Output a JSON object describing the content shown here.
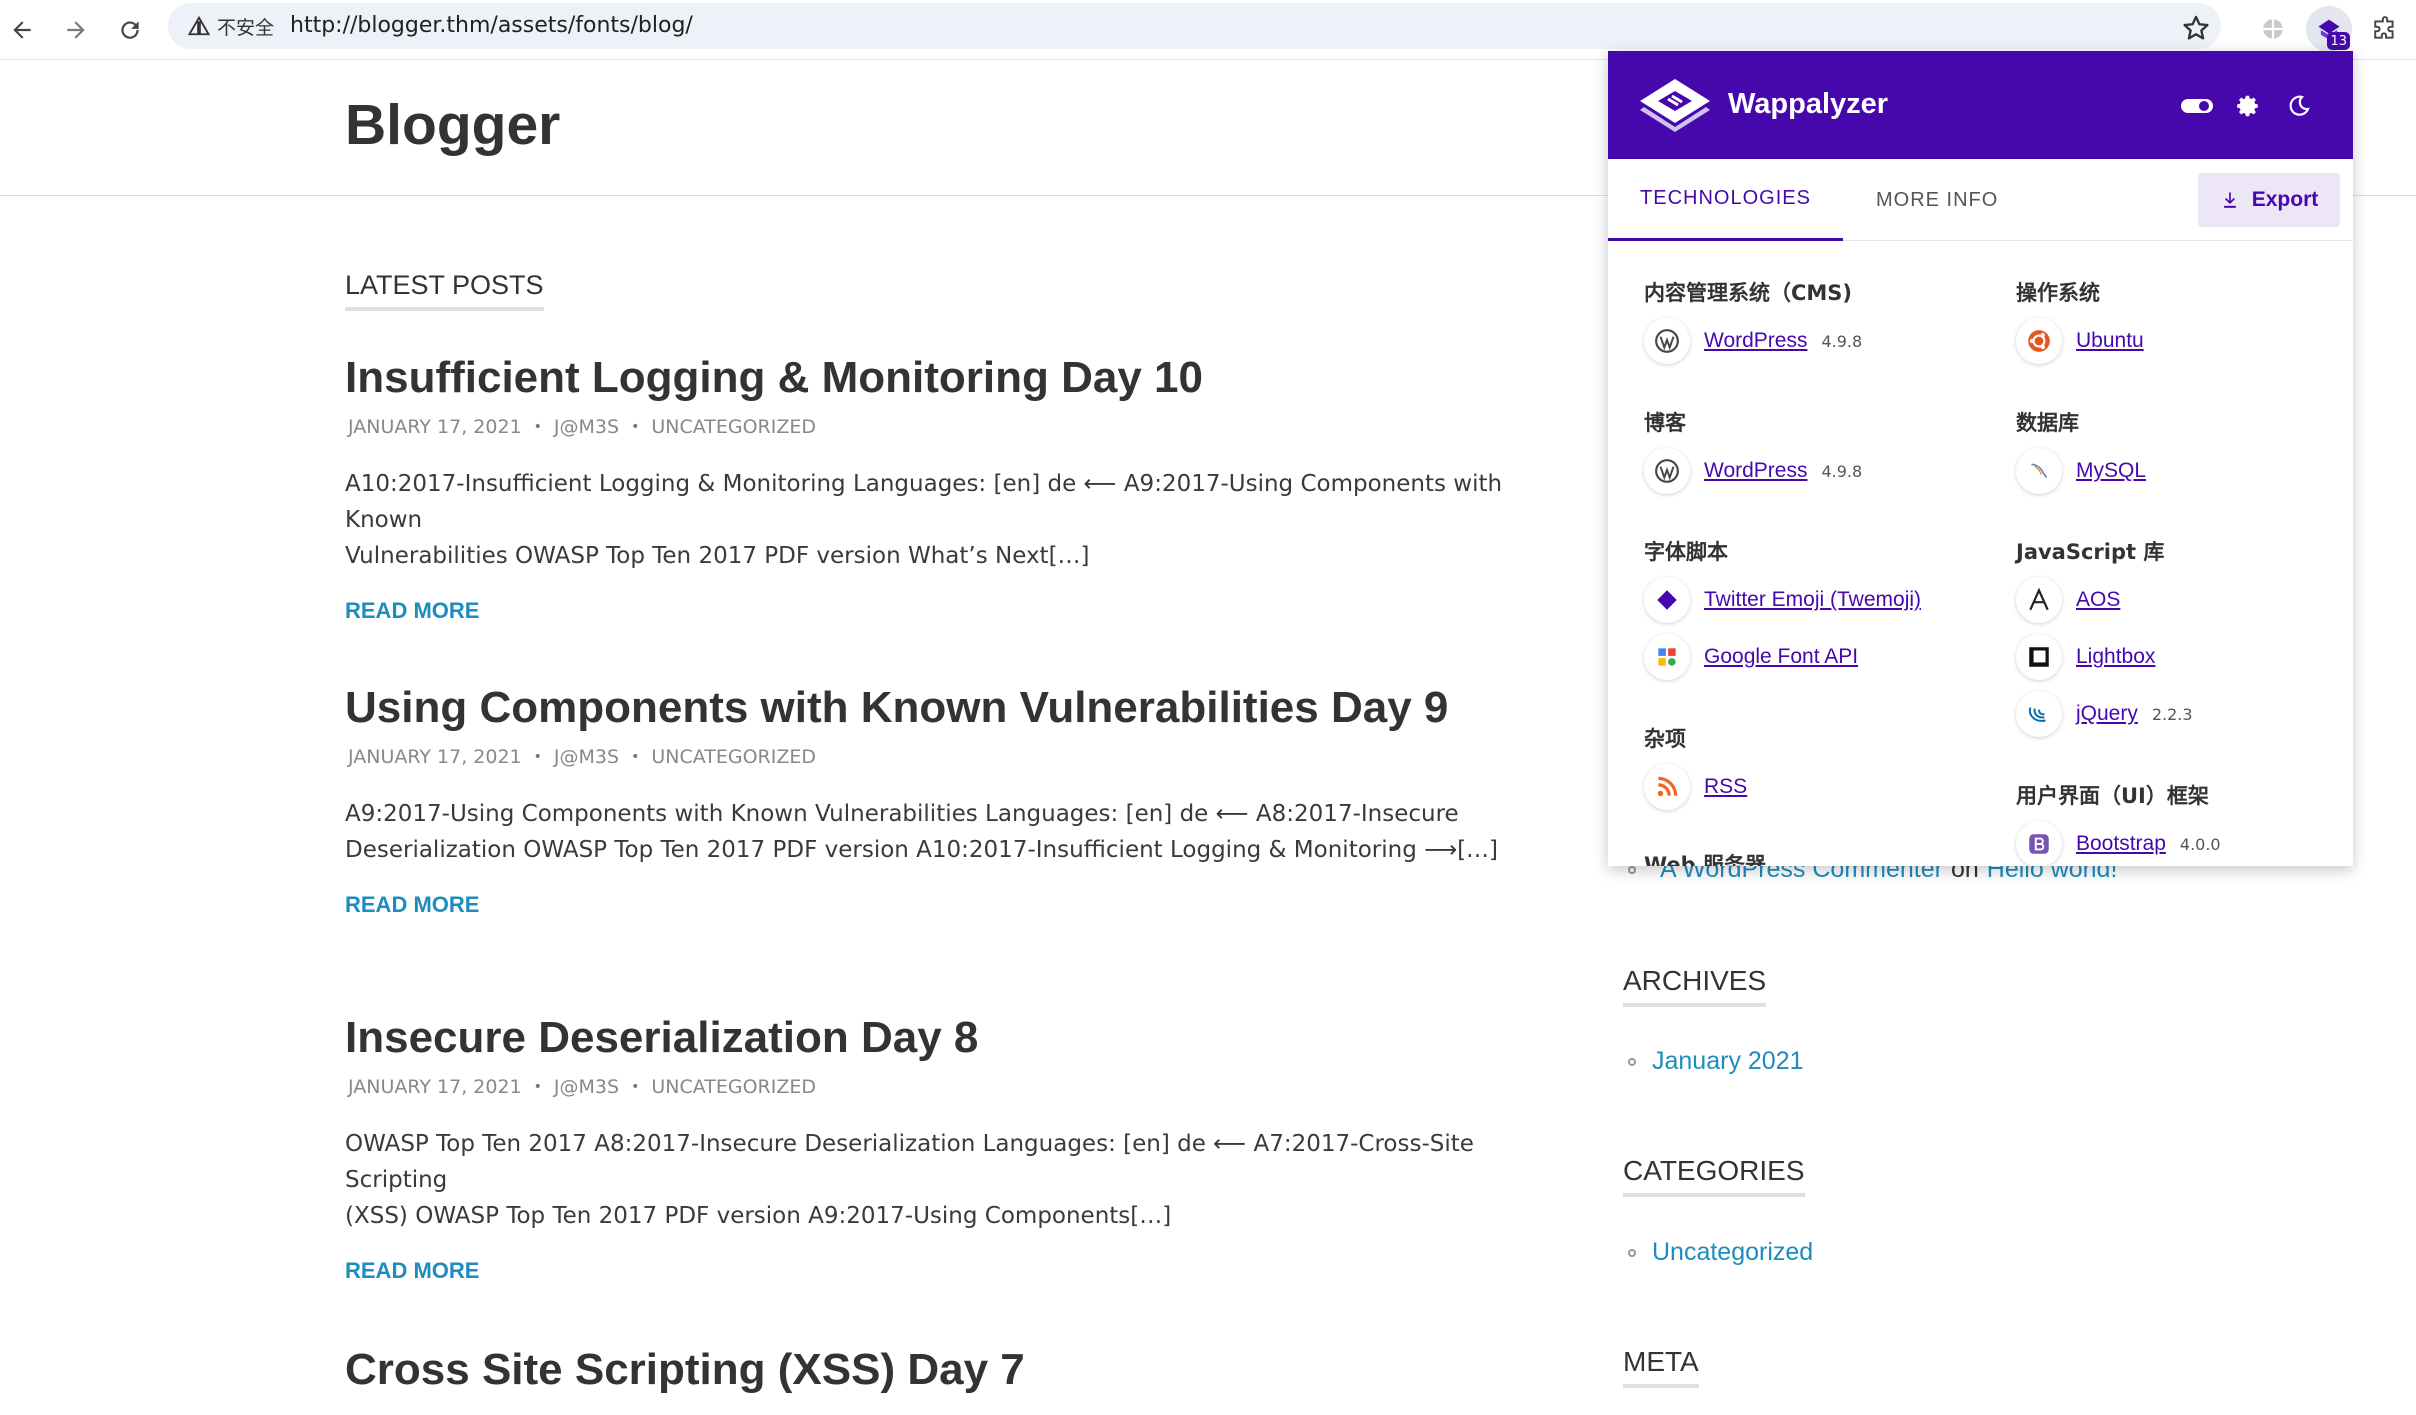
{
  "browser": {
    "security_label": "不安全",
    "url": "http://blogger.thm/assets/fonts/blog/",
    "extension_badge": "13"
  },
  "site": {
    "title": "Blogger",
    "latest_heading": "LATEST POSTS",
    "posts": [
      {
        "title": "Insufficient Logging & Monitoring Day 10",
        "date": "JANUARY 17, 2021",
        "author": "J@M3S",
        "category": "UNCATEGORIZED",
        "excerpt_line1": "A10:2017-Insufficient Logging & Monitoring Languages: [en] de ⟵ A9:2017-Using Components with Known",
        "excerpt_line2": "Vulnerabilities OWASP Top Ten 2017 PDF version What’s Next[…]",
        "read_more": "READ MORE"
      },
      {
        "title": "Using Components with Known Vulnerabilities Day 9",
        "date": "JANUARY 17, 2021",
        "author": "J@M3S",
        "category": "UNCATEGORIZED",
        "excerpt_line1": "A9:2017-Using Components with Known Vulnerabilities Languages: [en] de ⟵ A8:2017-Insecure",
        "excerpt_line2": "Deserialization OWASP Top Ten 2017 PDF version A10:2017-Insufficient Logging & Monitoring ⟶[…]",
        "read_more": "READ MORE"
      },
      {
        "title": "Insecure Deserialization Day 8",
        "date": "JANUARY 17, 2021",
        "author": "J@M3S",
        "category": "UNCATEGORIZED",
        "excerpt_line1": "OWASP Top Ten 2017 A8:2017-Insecure Deserialization Languages: [en] de ⟵ A7:2017-Cross-Site Scripting",
        "excerpt_line2": "(XSS) OWASP Top Ten 2017 PDF version A9:2017-Using Components[…]",
        "read_more": "READ MORE"
      },
      {
        "title": "Cross Site Scripting (XSS) Day 7"
      }
    ]
  },
  "sidebar": {
    "recent_comment": {
      "author": "A WordPress Commenter",
      "on": "on",
      "post": "Hello world!"
    },
    "archives_heading": "ARCHIVES",
    "archives": [
      "January 2021"
    ],
    "categories_heading": "CATEGORIES",
    "categories": [
      "Uncategorized"
    ],
    "meta_heading": "META"
  },
  "wappalyzer": {
    "name": "Wappalyzer",
    "tabs": {
      "technologies": "TECHNOLOGIES",
      "more_info": "MORE INFO"
    },
    "export_label": "Export",
    "left": [
      {
        "category": "内容管理系统（CMS)",
        "items": [
          {
            "name": "WordPress",
            "version": "4.9.8"
          }
        ]
      },
      {
        "category": "博客",
        "items": [
          {
            "name": "WordPress",
            "version": "4.9.8"
          }
        ]
      },
      {
        "category": "字体脚本",
        "items": [
          {
            "name": "Twitter Emoji (Twemoji)"
          },
          {
            "name": "Google Font API"
          }
        ]
      },
      {
        "category": "杂项",
        "items": [
          {
            "name": "RSS"
          }
        ]
      },
      {
        "category": "Web 服务器"
      }
    ],
    "right": [
      {
        "category": "操作系统",
        "items": [
          {
            "name": "Ubuntu"
          }
        ]
      },
      {
        "category": "数据库",
        "items": [
          {
            "name": "MySQL"
          }
        ]
      },
      {
        "category": "JavaScript 库",
        "items": [
          {
            "name": "AOS"
          },
          {
            "name": "Lightbox"
          },
          {
            "name": "jQuery",
            "version": "2.2.3"
          }
        ]
      },
      {
        "category": "用户界面（UI）框架",
        "items": [
          {
            "name": "Bootstrap",
            "version": "4.0.0"
          }
        ]
      }
    ],
    "colors": {
      "brand": "#4608ad",
      "link": "#1e8cbe"
    }
  }
}
